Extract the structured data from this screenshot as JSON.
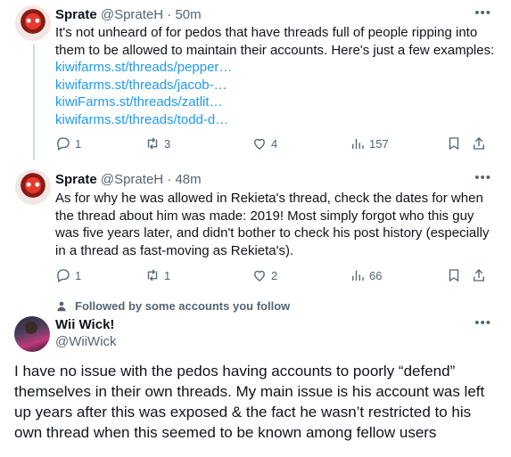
{
  "tweets": [
    {
      "name": "Sprate",
      "handle": "@SprateH",
      "time": "· 50m",
      "text": "It's not unheard of for pedos that have threads full of people ripping into them to be allowed to maintain their accounts. Here's just a few examples:",
      "links": [
        "kiwifarms.st/threads/pepper…",
        "kiwifarms.st/threads/jacob-…",
        "kiwiFarms.st/threads/zatlit…",
        "kiwifarms.st/threads/todd-d…"
      ],
      "replies": "1",
      "reposts": "3",
      "likes": "4",
      "views": "157"
    },
    {
      "name": "Sprate",
      "handle": "@SprateH",
      "time": "· 48m",
      "text": "As for why he was allowed in Rekieta's thread, check the dates for when the thread about him was made: 2019! Most simply forgot who this guy was five years later, and didn't bother to check his post history (especially in a thread as fast-moving as Rekieta's).",
      "replies": "1",
      "reposts": "1",
      "likes": "2",
      "views": "66"
    }
  ],
  "social_context": "Followed by some accounts you follow",
  "main": {
    "name": "Wii Wick!",
    "handle": "@WiiWick",
    "text": "I have no issue with the pedos having accounts to poorly “defend” themselves in their own threads. My main issue is his account was left up years after this was exposed & the fact he wasn’t restricted to his own thread when this seemed to be known among fellow users"
  },
  "icons": {
    "reply": "reply-icon",
    "repost": "repost-icon",
    "like": "heart-icon",
    "views": "views-icon",
    "bookmark": "bookmark-icon",
    "share": "share-icon",
    "more": "more-icon",
    "follow": "person-icon"
  }
}
